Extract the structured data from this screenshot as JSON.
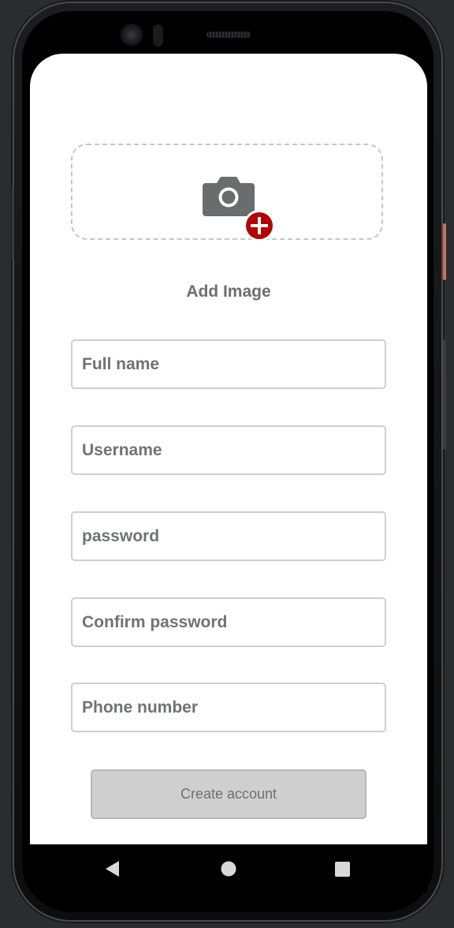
{
  "screen": {
    "image_picker": {
      "label": "Add Image",
      "icon": "camera-icon",
      "badge_icon": "add-circle-icon",
      "badge_color": "#b30000"
    },
    "fields": {
      "full_name": {
        "placeholder": "Full name",
        "value": ""
      },
      "username": {
        "placeholder": "Username",
        "value": ""
      },
      "password": {
        "placeholder": "password",
        "value": ""
      },
      "confirm_password": {
        "placeholder": "Confirm password",
        "value": ""
      },
      "phone_number": {
        "placeholder": "Phone number",
        "value": ""
      }
    },
    "create_button": {
      "label": "Create account"
    }
  },
  "navigation_bar": {
    "back_icon": "back-triangle-icon",
    "home_icon": "home-circle-icon",
    "recents_icon": "recents-square-icon"
  }
}
